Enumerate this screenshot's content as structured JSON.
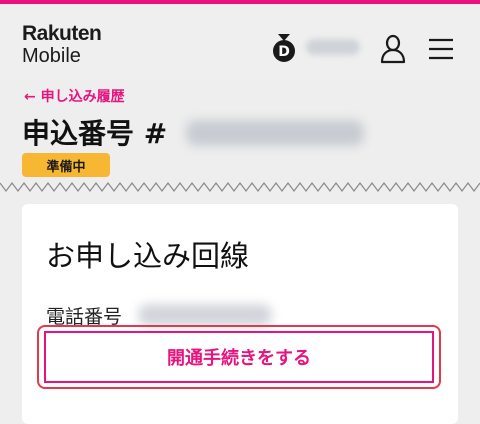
{
  "header": {
    "logo_line1": "Rakuten",
    "logo_line2": "Mobile",
    "medal_letter": "D",
    "icons": [
      "medal-icon",
      "user-icon",
      "menu-icon"
    ]
  },
  "nav": {
    "back_link": "← 申し込み履歴"
  },
  "page": {
    "title": "申込番号 #",
    "status_badge": "準備中"
  },
  "card": {
    "title": "お申し込み回線",
    "phone_label": "電話番号",
    "cta_label": "開通手続きをする"
  },
  "colors": {
    "accent": "#e8137e",
    "badge": "#f7b733",
    "highlight_outline": "#e23a4a"
  }
}
